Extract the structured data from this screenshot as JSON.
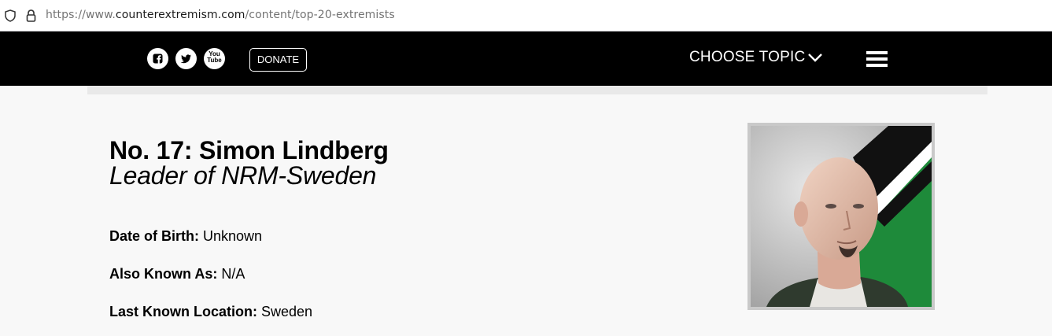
{
  "browser": {
    "url_scheme": "https://www.",
    "url_host": "counterextremism.com",
    "url_path": "/content/top-20-extremists"
  },
  "header": {
    "social": [
      "facebook-icon",
      "twitter-icon",
      "youtube-icon"
    ],
    "youtube_text_top": "You",
    "youtube_text_bottom": "Tube",
    "donate_label": "DONATE",
    "choose_topic_label": "CHOOSE TOPIC",
    "menu_icon": "hamburger-menu-icon"
  },
  "profile": {
    "name": "No. 17: Simon Lindberg",
    "role": "Leader of NRM-Sweden",
    "facts": [
      {
        "label": "Date of Birth:",
        "value": "Unknown"
      },
      {
        "label": "Also Known As:",
        "value": "N/A"
      },
      {
        "label": "Last Known Location:",
        "value": "Sweden"
      }
    ]
  },
  "colors": {
    "header_bg": "#000000",
    "page_bg": "#f8f8f8",
    "flag_green": "#1e8a3a"
  }
}
